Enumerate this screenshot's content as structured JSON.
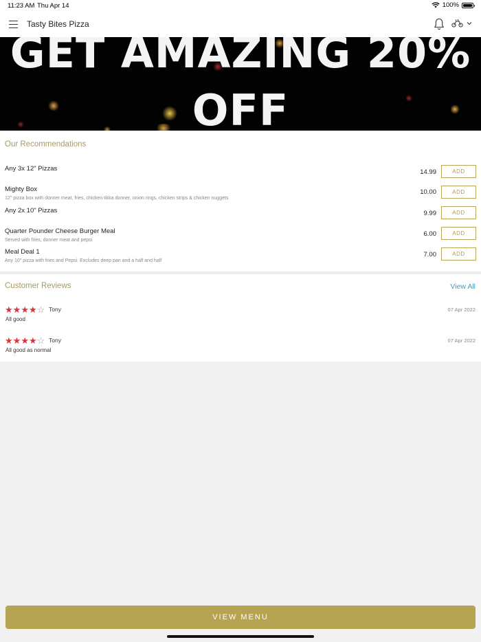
{
  "status_bar": {
    "time": "11:23 AM",
    "date": "Thu Apr 14",
    "battery": "100%"
  },
  "nav": {
    "title": "Tasty Bites Pizza"
  },
  "banner": {
    "line1": "GET AMAZING 20%",
    "line2": "OFF"
  },
  "recommendations": {
    "title": "Our Recommendations",
    "items": [
      {
        "name": "Any 3x 12\" Pizzas",
        "description": "",
        "price": "14.99",
        "button": "ADD"
      },
      {
        "name": "Mighty Box",
        "description": "12\" pizza box with donner meat, fries, chicken tikka donner, onion rings, chicken strips & chicken nuggets",
        "price": "10.00",
        "button": "ADD"
      },
      {
        "name": "Any 2x 10\" Pizzas",
        "description": "",
        "price": "9.99",
        "button": "ADD"
      },
      {
        "name": "Quarter Pounder Cheese Burger Meal",
        "description": "Served with fries, donner meat and pepsi",
        "price": "6.00",
        "button": "ADD"
      },
      {
        "name": "Meal Deal 1",
        "description": "Any 10\" pizza with fries and Pepsi. Excludes deep pan and a half and half",
        "price": "7.00",
        "button": "ADD"
      }
    ]
  },
  "reviews": {
    "title": "Customer Reviews",
    "view_all": "View All",
    "items": [
      {
        "rating": 4,
        "max": 5,
        "reviewer": "Tony",
        "date": "07 Apr 2022",
        "text": "All good"
      },
      {
        "rating": 4,
        "max": 5,
        "reviewer": "Tony",
        "date": "07 Apr 2022",
        "text": "All good as normal"
      }
    ]
  },
  "footer": {
    "view_menu": "VIEW MENU"
  },
  "colors": {
    "accent": "#b6a452",
    "star": "#d9343b",
    "link": "#3a9bbf"
  },
  "icons": [
    "menu-icon",
    "bell-icon",
    "scooter-icon",
    "chevron-down-icon",
    "wifi-icon",
    "battery-icon",
    "star-icon"
  ]
}
